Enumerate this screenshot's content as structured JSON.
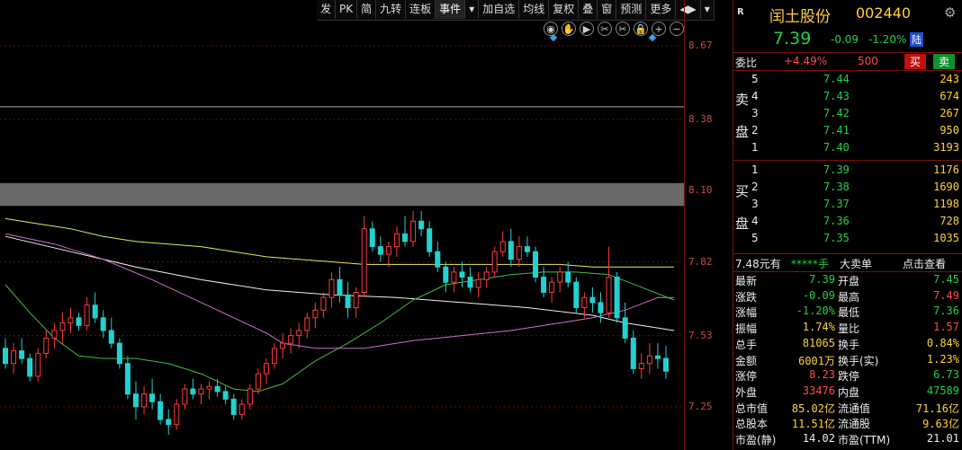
{
  "toolbar": {
    "items": [
      "发",
      "PK",
      "简",
      "九转",
      "连板",
      "事件",
      "▾",
      "加自选",
      "均线",
      "复权",
      "叠",
      "窗",
      "预测",
      "更多",
      "◀▶",
      "▾"
    ]
  },
  "icons": [
    "eye-icon",
    "hand-icon",
    "play-icon",
    "scissors-icon",
    "scissors-alt-icon",
    "lock-icon",
    "zoom-in-icon",
    "zoom-out-icon"
  ],
  "yaxis": {
    "ticks": [
      "8.67",
      "8.38",
      "8.10",
      "7.82",
      "7.53",
      "7.25"
    ]
  },
  "chart_data": {
    "type": "candlestick",
    "ylim": [
      7.08,
      8.85
    ],
    "candles": [
      [
        7.48,
        7.52,
        7.4,
        7.42
      ],
      [
        7.42,
        7.5,
        7.38,
        7.47
      ],
      [
        7.47,
        7.52,
        7.42,
        7.44
      ],
      [
        7.44,
        7.46,
        7.35,
        7.37
      ],
      [
        7.37,
        7.48,
        7.35,
        7.46
      ],
      [
        7.46,
        7.55,
        7.44,
        7.52
      ],
      [
        7.52,
        7.58,
        7.48,
        7.55
      ],
      [
        7.55,
        7.62,
        7.5,
        7.58
      ],
      [
        7.58,
        7.64,
        7.54,
        7.6
      ],
      [
        7.6,
        7.62,
        7.55,
        7.57
      ],
      [
        7.57,
        7.68,
        7.55,
        7.65
      ],
      [
        7.65,
        7.7,
        7.58,
        7.6
      ],
      [
        7.6,
        7.63,
        7.52,
        7.55
      ],
      [
        7.55,
        7.6,
        7.48,
        7.5
      ],
      [
        7.5,
        7.52,
        7.4,
        7.42
      ],
      [
        7.42,
        7.45,
        7.28,
        7.3
      ],
      [
        7.3,
        7.35,
        7.2,
        7.25
      ],
      [
        7.25,
        7.33,
        7.22,
        7.3
      ],
      [
        7.3,
        7.36,
        7.24,
        7.27
      ],
      [
        7.27,
        7.3,
        7.18,
        7.2
      ],
      [
        7.2,
        7.24,
        7.14,
        7.18
      ],
      [
        7.18,
        7.28,
        7.16,
        7.26
      ],
      [
        7.26,
        7.34,
        7.24,
        7.32
      ],
      [
        7.32,
        7.36,
        7.28,
        7.3
      ],
      [
        7.3,
        7.34,
        7.26,
        7.32
      ],
      [
        7.32,
        7.35,
        7.28,
        7.33
      ],
      [
        7.33,
        7.36,
        7.29,
        7.31
      ],
      [
        7.31,
        7.33,
        7.26,
        7.28
      ],
      [
        7.28,
        7.3,
        7.2,
        7.22
      ],
      [
        7.22,
        7.28,
        7.2,
        7.26
      ],
      [
        7.26,
        7.34,
        7.24,
        7.32
      ],
      [
        7.32,
        7.4,
        7.3,
        7.38
      ],
      [
        7.38,
        7.44,
        7.34,
        7.42
      ],
      [
        7.42,
        7.5,
        7.4,
        7.48
      ],
      [
        7.48,
        7.54,
        7.44,
        7.5
      ],
      [
        7.5,
        7.56,
        7.46,
        7.53
      ],
      [
        7.53,
        7.58,
        7.48,
        7.55
      ],
      [
        7.55,
        7.62,
        7.52,
        7.6
      ],
      [
        7.6,
        7.66,
        7.56,
        7.63
      ],
      [
        7.63,
        7.7,
        7.6,
        7.68
      ],
      [
        7.68,
        7.78,
        7.64,
        7.75
      ],
      [
        7.75,
        7.8,
        7.66,
        7.69
      ],
      [
        7.69,
        7.74,
        7.6,
        7.64
      ],
      [
        7.64,
        7.72,
        7.6,
        7.7
      ],
      [
        7.7,
        8.0,
        7.68,
        7.95
      ],
      [
        7.95,
        7.98,
        7.86,
        7.88
      ],
      [
        7.88,
        7.92,
        7.82,
        7.85
      ],
      [
        7.85,
        7.9,
        7.8,
        7.88
      ],
      [
        7.88,
        7.96,
        7.84,
        7.93
      ],
      [
        7.93,
        8.0,
        7.88,
        7.9
      ],
      [
        7.9,
        8.02,
        7.88,
        7.98
      ],
      [
        7.98,
        8.02,
        7.92,
        7.95
      ],
      [
        7.95,
        7.98,
        7.84,
        7.86
      ],
      [
        7.86,
        7.9,
        7.78,
        7.8
      ],
      [
        7.8,
        7.82,
        7.7,
        7.74
      ],
      [
        7.74,
        7.8,
        7.7,
        7.78
      ],
      [
        7.78,
        7.82,
        7.72,
        7.76
      ],
      [
        7.76,
        7.8,
        7.7,
        7.72
      ],
      [
        7.72,
        7.78,
        7.68,
        7.75
      ],
      [
        7.75,
        7.8,
        7.72,
        7.78
      ],
      [
        7.78,
        7.88,
        7.76,
        7.86
      ],
      [
        7.86,
        7.94,
        7.84,
        7.9
      ],
      [
        7.9,
        7.95,
        7.8,
        7.83
      ],
      [
        7.83,
        7.92,
        7.8,
        7.88
      ],
      [
        7.88,
        7.92,
        7.84,
        7.86
      ],
      [
        7.86,
        7.88,
        7.74,
        7.76
      ],
      [
        7.76,
        7.8,
        7.68,
        7.7
      ],
      [
        7.7,
        7.76,
        7.66,
        7.74
      ],
      [
        7.74,
        7.8,
        7.7,
        7.78
      ],
      [
        7.78,
        7.82,
        7.72,
        7.74
      ],
      [
        7.74,
        7.76,
        7.62,
        7.64
      ],
      [
        7.64,
        7.7,
        7.6,
        7.68
      ],
      [
        7.68,
        7.72,
        7.62,
        7.66
      ],
      [
        7.66,
        7.7,
        7.58,
        7.62
      ],
      [
        7.62,
        7.88,
        7.6,
        7.76
      ],
      [
        7.76,
        7.78,
        7.58,
        7.6
      ],
      [
        7.6,
        7.66,
        7.5,
        7.52
      ],
      [
        7.52,
        7.55,
        7.38,
        7.4
      ],
      [
        7.4,
        7.46,
        7.36,
        7.42
      ],
      [
        7.42,
        7.5,
        7.38,
        7.45
      ],
      [
        7.45,
        7.5,
        7.4,
        7.44
      ],
      [
        7.44,
        7.49,
        7.36,
        7.39
      ]
    ],
    "ma_lines": [
      {
        "color": "#e8e860",
        "points": [
          [
            0,
            7.99
          ],
          [
            4,
            7.97
          ],
          [
            8,
            7.95
          ],
          [
            12,
            7.92
          ],
          [
            16,
            7.9
          ],
          [
            20,
            7.89
          ],
          [
            24,
            7.88
          ],
          [
            28,
            7.86
          ],
          [
            32,
            7.84
          ],
          [
            36,
            7.83
          ],
          [
            40,
            7.82
          ],
          [
            44,
            7.81
          ],
          [
            48,
            7.81
          ],
          [
            52,
            7.81
          ],
          [
            56,
            7.81
          ],
          [
            60,
            7.81
          ],
          [
            64,
            7.81
          ],
          [
            68,
            7.81
          ],
          [
            72,
            7.8
          ],
          [
            76,
            7.8
          ],
          [
            80,
            7.8
          ],
          [
            82,
            7.8
          ]
        ]
      },
      {
        "color": "#f0f0f0",
        "points": [
          [
            0,
            7.92
          ],
          [
            8,
            7.86
          ],
          [
            16,
            7.8
          ],
          [
            24,
            7.75
          ],
          [
            32,
            7.71
          ],
          [
            40,
            7.69
          ],
          [
            48,
            7.68
          ],
          [
            56,
            7.66
          ],
          [
            64,
            7.64
          ],
          [
            72,
            7.61
          ],
          [
            76,
            7.58
          ],
          [
            80,
            7.56
          ],
          [
            82,
            7.55
          ]
        ]
      },
      {
        "color": "#d070d0",
        "points": [
          [
            0,
            7.93
          ],
          [
            6,
            7.89
          ],
          [
            12,
            7.83
          ],
          [
            18,
            7.75
          ],
          [
            24,
            7.66
          ],
          [
            28,
            7.6
          ],
          [
            32,
            7.54
          ],
          [
            34,
            7.5
          ],
          [
            38,
            7.48
          ],
          [
            44,
            7.48
          ],
          [
            50,
            7.51
          ],
          [
            56,
            7.53
          ],
          [
            62,
            7.55
          ],
          [
            68,
            7.58
          ],
          [
            72,
            7.6
          ],
          [
            76,
            7.63
          ],
          [
            80,
            7.68
          ],
          [
            82,
            7.68
          ]
        ]
      },
      {
        "color": "#40c040",
        "points": [
          [
            0,
            7.73
          ],
          [
            3,
            7.62
          ],
          [
            6,
            7.52
          ],
          [
            9,
            7.45
          ],
          [
            12,
            7.44
          ],
          [
            16,
            7.44
          ],
          [
            20,
            7.42
          ],
          [
            24,
            7.38
          ],
          [
            28,
            7.32
          ],
          [
            31,
            7.31
          ],
          [
            34,
            7.34
          ],
          [
            38,
            7.43
          ],
          [
            42,
            7.5
          ],
          [
            46,
            7.58
          ],
          [
            50,
            7.67
          ],
          [
            54,
            7.73
          ],
          [
            58,
            7.75
          ],
          [
            62,
            7.77
          ],
          [
            66,
            7.78
          ],
          [
            70,
            7.78
          ],
          [
            74,
            7.77
          ],
          [
            78,
            7.72
          ],
          [
            82,
            7.67
          ]
        ]
      }
    ]
  },
  "panel": {
    "r_label": "R",
    "stock_name": "闰土股份",
    "stock_code": "002440",
    "price": "7.39",
    "change": "-0.09",
    "change_pct": "-1.20%",
    "board_tag": "陆",
    "weibi_label": "委比",
    "weibi_value": "+4.49%",
    "weicha_value": "500",
    "buy_btn": "买",
    "sell_btn": "卖",
    "sell_label_1": "卖",
    "sell_label_2": "盘",
    "buy_label_1": "买",
    "buy_label_2": "盘",
    "asks": [
      {
        "level": "5",
        "price": "7.44",
        "vol": "243"
      },
      {
        "level": "4",
        "price": "7.43",
        "vol": "674"
      },
      {
        "level": "3",
        "price": "7.42",
        "vol": "267"
      },
      {
        "level": "2",
        "price": "7.41",
        "vol": "950"
      },
      {
        "level": "1",
        "price": "7.40",
        "vol": "3193"
      }
    ],
    "bids": [
      {
        "level": "1",
        "price": "7.39",
        "vol": "1176"
      },
      {
        "level": "2",
        "price": "7.38",
        "vol": "1690"
      },
      {
        "level": "3",
        "price": "7.37",
        "vol": "1198"
      },
      {
        "level": "4",
        "price": "7.36",
        "vol": "728"
      },
      {
        "level": "5",
        "price": "7.35",
        "vol": "1035"
      }
    ],
    "bigorder": {
      "price": "7.48元有",
      "stars": "*****手",
      "label": "大卖单",
      "link": "点击查看"
    },
    "stats": [
      {
        "l1": "最新",
        "v1": "7.39",
        "c1": "green",
        "l2": "开盘",
        "v2": "7.45",
        "c2": "green"
      },
      {
        "l1": "涨跌",
        "v1": "-0.09",
        "c1": "green",
        "l2": "最高",
        "v2": "7.49",
        "c2": "red"
      },
      {
        "l1": "涨幅",
        "v1": "-1.20%",
        "c1": "green",
        "l2": "最低",
        "v2": "7.36",
        "c2": "green"
      },
      {
        "l1": "振幅",
        "v1": "1.74%",
        "c1": "yellow",
        "l2": "量比",
        "v2": "1.57",
        "c2": "red"
      },
      {
        "l1": "总手",
        "v1": "81065",
        "c1": "yellow",
        "l2": "换手",
        "v2": "0.84%",
        "c2": "yellow"
      },
      {
        "l1": "金额",
        "v1": "6001万",
        "c1": "yellow",
        "l2": "换手(实)",
        "v2": "1.23%",
        "c2": "yellow"
      },
      {
        "l1": "涨停",
        "v1": "8.23",
        "c1": "red",
        "l2": "跌停",
        "v2": "6.73",
        "c2": "green"
      },
      {
        "l1": "外盘",
        "v1": "33476",
        "c1": "red",
        "l2": "内盘",
        "v2": "47589",
        "c2": "green"
      },
      {
        "l1": "总市值",
        "v1": "85.02亿",
        "c1": "yellow",
        "l2": "流通值",
        "v2": "71.16亿",
        "c2": "yellow"
      },
      {
        "l1": "总股本",
        "v1": "11.51亿",
        "c1": "yellow",
        "l2": "流通股",
        "v2": "9.63亿",
        "c2": "yellow"
      },
      {
        "l1": "市盈(静)",
        "v1": "14.02",
        "c1": "white",
        "l2": "市盈(TTM)",
        "v2": "21.01",
        "c2": "white"
      }
    ],
    "colors": {
      "up": "#ff3b3b",
      "down": "#23d1d1",
      "price_green": "#23d14a"
    }
  }
}
